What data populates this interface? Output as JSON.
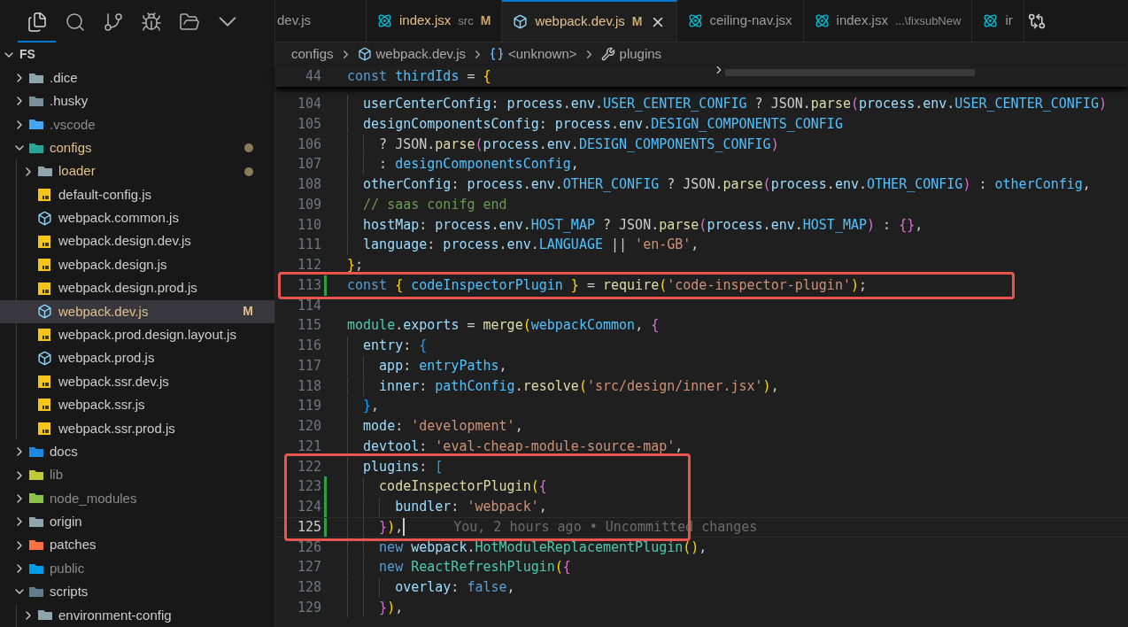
{
  "activity_tabs": [
    {
      "kind": "explorer",
      "selected": true
    },
    {
      "kind": "search",
      "selected": false
    },
    {
      "kind": "source-control",
      "selected": false
    },
    {
      "kind": "run",
      "selected": false
    },
    {
      "kind": "folders",
      "selected": false
    },
    {
      "kind": "more",
      "selected": false
    }
  ],
  "explorer": {
    "root": {
      "label": "FS",
      "expanded": true
    },
    "items": [
      {
        "kind": "folder",
        "label": ".dice",
        "expanded": false,
        "selected": false,
        "changed": false,
        "ignored": false
      },
      {
        "kind": "husky-folder",
        "label": ".husky",
        "expanded": false,
        "selected": false,
        "changed": false,
        "ignored": false
      },
      {
        "kind": "vscode-folder",
        "label": ".vscode",
        "expanded": false,
        "selected": false,
        "changed": false,
        "ignored": true
      },
      {
        "kind": "config-folder",
        "label": "configs",
        "expanded": true,
        "selected": false,
        "changed": true,
        "ignored": false,
        "children": [
          {
            "kind": "folder",
            "label": "loader",
            "expanded": false,
            "selected": false,
            "changed": true,
            "ignored": false
          },
          {
            "kind": "js-file",
            "label": "default-config.js",
            "selected": false,
            "changed": false,
            "ignored": false
          },
          {
            "kind": "webpack-file",
            "label": "webpack.common.js",
            "selected": false,
            "changed": false,
            "ignored": false
          },
          {
            "kind": "js-file",
            "label": "webpack.design.dev.js",
            "selected": false,
            "changed": false,
            "ignored": false
          },
          {
            "kind": "js-file",
            "label": "webpack.design.js",
            "selected": false,
            "changed": false,
            "ignored": false
          },
          {
            "kind": "js-file",
            "label": "webpack.design.prod.js",
            "selected": false,
            "changed": false,
            "ignored": false
          },
          {
            "kind": "webpack-file",
            "label": "webpack.dev.js",
            "selected": true,
            "changed": true,
            "ignored": false,
            "badge": "M"
          },
          {
            "kind": "js-file",
            "label": "webpack.prod.design.layout.js",
            "selected": false,
            "changed": false,
            "ignored": false
          },
          {
            "kind": "webpack-file",
            "label": "webpack.prod.js",
            "selected": false,
            "changed": false,
            "ignored": false
          },
          {
            "kind": "js-file",
            "label": "webpack.ssr.dev.js",
            "selected": false,
            "changed": false,
            "ignored": false
          },
          {
            "kind": "js-file",
            "label": "webpack.ssr.js",
            "selected": false,
            "changed": false,
            "ignored": false
          },
          {
            "kind": "js-file",
            "label": "webpack.ssr.prod.js",
            "selected": false,
            "changed": false,
            "ignored": false
          }
        ]
      },
      {
        "kind": "docs-folder",
        "label": "docs",
        "expanded": false,
        "selected": false,
        "changed": false,
        "ignored": false
      },
      {
        "kind": "lib-folder",
        "label": "lib",
        "expanded": false,
        "selected": false,
        "changed": false,
        "ignored": true
      },
      {
        "kind": "node-folder",
        "label": "node_modules",
        "expanded": false,
        "selected": false,
        "changed": false,
        "ignored": true
      },
      {
        "kind": "folder",
        "label": "origin",
        "expanded": false,
        "selected": false,
        "changed": false,
        "ignored": false
      },
      {
        "kind": "patches-folder",
        "label": "patches",
        "expanded": false,
        "selected": false,
        "changed": false,
        "ignored": false
      },
      {
        "kind": "public-folder",
        "label": "public",
        "expanded": false,
        "selected": false,
        "changed": false,
        "ignored": true
      },
      {
        "kind": "scripts-folder",
        "label": "scripts",
        "expanded": true,
        "selected": false,
        "changed": false,
        "ignored": false,
        "children": [
          {
            "kind": "folder",
            "label": "environment-config",
            "expanded": false,
            "selected": false,
            "changed": false,
            "ignored": false
          }
        ]
      }
    ]
  },
  "tabs": [
    {
      "kind": "plain",
      "label": "dev.js",
      "selected": false,
      "changed": false
    },
    {
      "kind": "react-file",
      "label": "index.jsx",
      "detail": "src",
      "badge": "M",
      "selected": false,
      "changed": true
    },
    {
      "kind": "webpack-file",
      "label": "webpack.dev.js",
      "badge": "M",
      "selected": true,
      "changed": true
    },
    {
      "kind": "react-file",
      "label": "ceiling-nav.jsx",
      "selected": false,
      "changed": false
    },
    {
      "kind": "react-file",
      "label": "index.jsx",
      "detail": "...\\fixsubNew",
      "selected": false,
      "changed": false
    },
    {
      "kind": "react-file",
      "label": "ir",
      "selected": false,
      "changed": false
    }
  ],
  "breadcrumb": [
    {
      "kind": "folder",
      "label": "configs"
    },
    {
      "kind": "webpack-file",
      "label": "webpack.dev.js"
    },
    {
      "kind": "symbol",
      "label": "<unknown>"
    },
    {
      "kind": "property",
      "label": "plugins"
    }
  ],
  "editor": {
    "sticky_line": {
      "number": "44",
      "tokens": [
        {
          "kind": "keyword",
          "text": "const "
        },
        {
          "kind": "constant",
          "text": "thirdIds"
        },
        {
          "kind": "punct",
          "text": " = "
        },
        {
          "kind": "bracket-gold",
          "text": "{"
        }
      ]
    },
    "lines": [
      {
        "number": "104",
        "changed": false,
        "current": false,
        "boxed": false,
        "tokens": [
          {
            "kind": "variable",
            "text": "  userCenterConfig"
          },
          {
            "kind": "punct",
            "text": ": "
          },
          {
            "kind": "variable",
            "text": "process"
          },
          {
            "kind": "punct",
            "text": "."
          },
          {
            "kind": "variable",
            "text": "env"
          },
          {
            "kind": "punct",
            "text": "."
          },
          {
            "kind": "constant",
            "text": "USER_CENTER_CONFIG"
          },
          {
            "kind": "punct",
            "text": " ? JSON."
          },
          {
            "kind": "function",
            "text": "parse"
          },
          {
            "kind": "bracket-pink",
            "text": "("
          },
          {
            "kind": "variable",
            "text": "process"
          },
          {
            "kind": "punct",
            "text": "."
          },
          {
            "kind": "variable",
            "text": "env"
          },
          {
            "kind": "punct",
            "text": "."
          },
          {
            "kind": "constant",
            "text": "USER_CENTER_CONFIG"
          },
          {
            "kind": "bracket-pink",
            "text": ")"
          }
        ]
      },
      {
        "number": "105",
        "changed": false,
        "current": false,
        "boxed": false,
        "tokens": [
          {
            "kind": "variable",
            "text": "  designComponentsConfig"
          },
          {
            "kind": "punct",
            "text": ": "
          },
          {
            "kind": "variable",
            "text": "process"
          },
          {
            "kind": "punct",
            "text": "."
          },
          {
            "kind": "variable",
            "text": "env"
          },
          {
            "kind": "punct",
            "text": "."
          },
          {
            "kind": "constant",
            "text": "DESIGN_COMPONENTS_CONFIG"
          }
        ]
      },
      {
        "number": "106",
        "changed": false,
        "current": false,
        "boxed": false,
        "tokens": [
          {
            "kind": "punct",
            "text": "    ? JSON."
          },
          {
            "kind": "function",
            "text": "parse"
          },
          {
            "kind": "bracket-pink",
            "text": "("
          },
          {
            "kind": "variable",
            "text": "process"
          },
          {
            "kind": "punct",
            "text": "."
          },
          {
            "kind": "variable",
            "text": "env"
          },
          {
            "kind": "punct",
            "text": "."
          },
          {
            "kind": "constant",
            "text": "DESIGN_COMPONENTS_CONFIG"
          },
          {
            "kind": "bracket-pink",
            "text": ")"
          }
        ]
      },
      {
        "number": "107",
        "changed": false,
        "current": false,
        "boxed": false,
        "tokens": [
          {
            "kind": "punct",
            "text": "    : "
          },
          {
            "kind": "constant",
            "text": "designComponentsConfig"
          },
          {
            "kind": "punct",
            "text": ","
          }
        ]
      },
      {
        "number": "108",
        "changed": false,
        "current": false,
        "boxed": false,
        "tokens": [
          {
            "kind": "variable",
            "text": "  otherConfig"
          },
          {
            "kind": "punct",
            "text": ": "
          },
          {
            "kind": "variable",
            "text": "process"
          },
          {
            "kind": "punct",
            "text": "."
          },
          {
            "kind": "variable",
            "text": "env"
          },
          {
            "kind": "punct",
            "text": "."
          },
          {
            "kind": "constant",
            "text": "OTHER_CONFIG"
          },
          {
            "kind": "punct",
            "text": " ? JSON."
          },
          {
            "kind": "function",
            "text": "parse"
          },
          {
            "kind": "bracket-pink",
            "text": "("
          },
          {
            "kind": "variable",
            "text": "process"
          },
          {
            "kind": "punct",
            "text": "."
          },
          {
            "kind": "variable",
            "text": "env"
          },
          {
            "kind": "punct",
            "text": "."
          },
          {
            "kind": "constant",
            "text": "OTHER_CONFIG"
          },
          {
            "kind": "bracket-pink",
            "text": ")"
          },
          {
            "kind": "punct",
            "text": " : "
          },
          {
            "kind": "constant",
            "text": "otherConfig"
          },
          {
            "kind": "punct",
            "text": ","
          }
        ]
      },
      {
        "number": "109",
        "changed": false,
        "current": false,
        "boxed": false,
        "tokens": [
          {
            "kind": "comment",
            "text": "  // saas conifg end"
          }
        ]
      },
      {
        "number": "110",
        "changed": false,
        "current": false,
        "boxed": false,
        "tokens": [
          {
            "kind": "variable",
            "text": "  hostMap"
          },
          {
            "kind": "punct",
            "text": ": "
          },
          {
            "kind": "variable",
            "text": "process"
          },
          {
            "kind": "punct",
            "text": "."
          },
          {
            "kind": "variable",
            "text": "env"
          },
          {
            "kind": "punct",
            "text": "."
          },
          {
            "kind": "constant",
            "text": "HOST_MAP"
          },
          {
            "kind": "punct",
            "text": " ? JSON."
          },
          {
            "kind": "function",
            "text": "parse"
          },
          {
            "kind": "bracket-pink",
            "text": "("
          },
          {
            "kind": "variable",
            "text": "process"
          },
          {
            "kind": "punct",
            "text": "."
          },
          {
            "kind": "variable",
            "text": "env"
          },
          {
            "kind": "punct",
            "text": "."
          },
          {
            "kind": "constant",
            "text": "HOST_MAP"
          },
          {
            "kind": "bracket-pink",
            "text": ")"
          },
          {
            "kind": "punct",
            "text": " : "
          },
          {
            "kind": "bracket-pink",
            "text": "{}"
          },
          {
            "kind": "punct",
            "text": ","
          }
        ]
      },
      {
        "number": "111",
        "changed": false,
        "current": false,
        "boxed": false,
        "tokens": [
          {
            "kind": "variable",
            "text": "  language"
          },
          {
            "kind": "punct",
            "text": ": "
          },
          {
            "kind": "variable",
            "text": "process"
          },
          {
            "kind": "punct",
            "text": "."
          },
          {
            "kind": "variable",
            "text": "env"
          },
          {
            "kind": "punct",
            "text": "."
          },
          {
            "kind": "constant",
            "text": "LANGUAGE"
          },
          {
            "kind": "punct",
            "text": " || "
          },
          {
            "kind": "string",
            "text": "'en-GB'"
          },
          {
            "kind": "punct",
            "text": ","
          }
        ]
      },
      {
        "number": "112",
        "changed": false,
        "current": false,
        "boxed": false,
        "tokens": [
          {
            "kind": "bracket-gold",
            "text": "}"
          },
          {
            "kind": "punct",
            "text": ";"
          }
        ]
      },
      {
        "number": "113",
        "changed": true,
        "current": false,
        "boxed": true,
        "tokens": [
          {
            "kind": "keyword",
            "text": "const "
          },
          {
            "kind": "bracket-gold",
            "text": "{ "
          },
          {
            "kind": "constant",
            "text": "codeInspectorPlugin"
          },
          {
            "kind": "bracket-gold",
            "text": " }"
          },
          {
            "kind": "punct",
            "text": " = "
          },
          {
            "kind": "function",
            "text": "require"
          },
          {
            "kind": "bracket-gold",
            "text": "("
          },
          {
            "kind": "string",
            "text": "'code-inspector-plugin'"
          },
          {
            "kind": "bracket-gold",
            "text": ")"
          },
          {
            "kind": "punct",
            "text": ";"
          }
        ]
      },
      {
        "number": "114",
        "changed": false,
        "current": false,
        "boxed": false
      },
      {
        "number": "115",
        "changed": false,
        "current": false,
        "boxed": false,
        "tokens": [
          {
            "kind": "type",
            "text": "module"
          },
          {
            "kind": "punct",
            "text": "."
          },
          {
            "kind": "variable",
            "text": "exports"
          },
          {
            "kind": "punct",
            "text": " = "
          },
          {
            "kind": "function",
            "text": "merge"
          },
          {
            "kind": "bracket-gold",
            "text": "("
          },
          {
            "kind": "constant",
            "text": "webpackCommon"
          },
          {
            "kind": "punct",
            "text": ", "
          },
          {
            "kind": "bracket-pink",
            "text": "{"
          }
        ]
      },
      {
        "number": "116",
        "changed": false,
        "current": false,
        "boxed": false,
        "tokens": [
          {
            "kind": "variable",
            "text": "  entry"
          },
          {
            "kind": "punct",
            "text": ": "
          },
          {
            "kind": "bracket-blue",
            "text": "{"
          }
        ]
      },
      {
        "number": "117",
        "changed": false,
        "current": false,
        "boxed": false,
        "tokens": [
          {
            "kind": "variable",
            "text": "    app"
          },
          {
            "kind": "punct",
            "text": ": "
          },
          {
            "kind": "constant",
            "text": "entryPaths"
          },
          {
            "kind": "punct",
            "text": ","
          }
        ]
      },
      {
        "number": "118",
        "changed": false,
        "current": false,
        "boxed": false,
        "tokens": [
          {
            "kind": "variable",
            "text": "    inner"
          },
          {
            "kind": "punct",
            "text": ": "
          },
          {
            "kind": "constant",
            "text": "pathConfig"
          },
          {
            "kind": "punct",
            "text": "."
          },
          {
            "kind": "function",
            "text": "resolve"
          },
          {
            "kind": "bracket-gold",
            "text": "("
          },
          {
            "kind": "string",
            "text": "'src/design/inner.jsx'"
          },
          {
            "kind": "bracket-gold",
            "text": ")"
          },
          {
            "kind": "punct",
            "text": ","
          }
        ]
      },
      {
        "number": "119",
        "changed": false,
        "current": false,
        "boxed": false,
        "tokens": [
          {
            "kind": "bracket-blue",
            "text": "  }"
          },
          {
            "kind": "punct",
            "text": ","
          }
        ]
      },
      {
        "number": "120",
        "changed": false,
        "current": false,
        "boxed": false,
        "tokens": [
          {
            "kind": "variable",
            "text": "  mode"
          },
          {
            "kind": "punct",
            "text": ": "
          },
          {
            "kind": "string",
            "text": "'development'"
          },
          {
            "kind": "punct",
            "text": ","
          }
        ]
      },
      {
        "number": "121",
        "changed": false,
        "current": false,
        "boxed": false,
        "tokens": [
          {
            "kind": "variable",
            "text": "  devtool"
          },
          {
            "kind": "punct",
            "text": ": "
          },
          {
            "kind": "string",
            "text": "'eval-cheap-module-source-map'"
          },
          {
            "kind": "punct",
            "text": ","
          }
        ]
      },
      {
        "number": "122",
        "changed": false,
        "current": false,
        "boxed": true,
        "tokens": [
          {
            "kind": "variable",
            "text": "  plugins"
          },
          {
            "kind": "punct",
            "text": ": "
          },
          {
            "kind": "bracket-blue",
            "text": "["
          }
        ]
      },
      {
        "number": "123",
        "changed": true,
        "current": false,
        "boxed": true,
        "tokens": [
          {
            "kind": "function",
            "text": "    codeInspectorPlugin"
          },
          {
            "kind": "bracket-gold",
            "text": "("
          },
          {
            "kind": "bracket-pink",
            "text": "{"
          }
        ]
      },
      {
        "number": "124",
        "changed": true,
        "current": false,
        "boxed": true,
        "tokens": [
          {
            "kind": "variable",
            "text": "      bundler"
          },
          {
            "kind": "punct",
            "text": ": "
          },
          {
            "kind": "string",
            "text": "'webpack'"
          },
          {
            "kind": "punct",
            "text": ","
          }
        ]
      },
      {
        "number": "125",
        "changed": true,
        "current": true,
        "boxed": true,
        "blame": "You, 2 hours ago • Uncommitted changes",
        "tokens": [
          {
            "kind": "bracket-pink",
            "text": "    }"
          },
          {
            "kind": "bracket-gold",
            "text": ")"
          },
          {
            "kind": "punct",
            "text": ","
          }
        ]
      },
      {
        "number": "126",
        "changed": false,
        "current": false,
        "boxed": false,
        "tokens": [
          {
            "kind": "keyword",
            "text": "    new "
          },
          {
            "kind": "variable",
            "text": "webpack"
          },
          {
            "kind": "punct",
            "text": "."
          },
          {
            "kind": "type",
            "text": "HotModuleReplacementPlugin"
          },
          {
            "kind": "bracket-gold",
            "text": "()"
          },
          {
            "kind": "punct",
            "text": ","
          }
        ]
      },
      {
        "number": "127",
        "changed": false,
        "current": false,
        "boxed": false,
        "tokens": [
          {
            "kind": "keyword",
            "text": "    new "
          },
          {
            "kind": "type",
            "text": "ReactRefreshPlugin"
          },
          {
            "kind": "bracket-gold",
            "text": "("
          },
          {
            "kind": "bracket-pink",
            "text": "{"
          }
        ]
      },
      {
        "number": "128",
        "changed": false,
        "current": false,
        "boxed": false,
        "tokens": [
          {
            "kind": "variable",
            "text": "      overlay"
          },
          {
            "kind": "punct",
            "text": ": "
          },
          {
            "kind": "keyword",
            "text": "false"
          },
          {
            "kind": "punct",
            "text": ","
          }
        ]
      },
      {
        "number": "129",
        "changed": false,
        "current": false,
        "boxed": false,
        "tokens": [
          {
            "kind": "bracket-pink",
            "text": "    }"
          },
          {
            "kind": "bracket-gold",
            "text": ")"
          },
          {
            "kind": "punct",
            "text": ","
          }
        ]
      }
    ]
  }
}
